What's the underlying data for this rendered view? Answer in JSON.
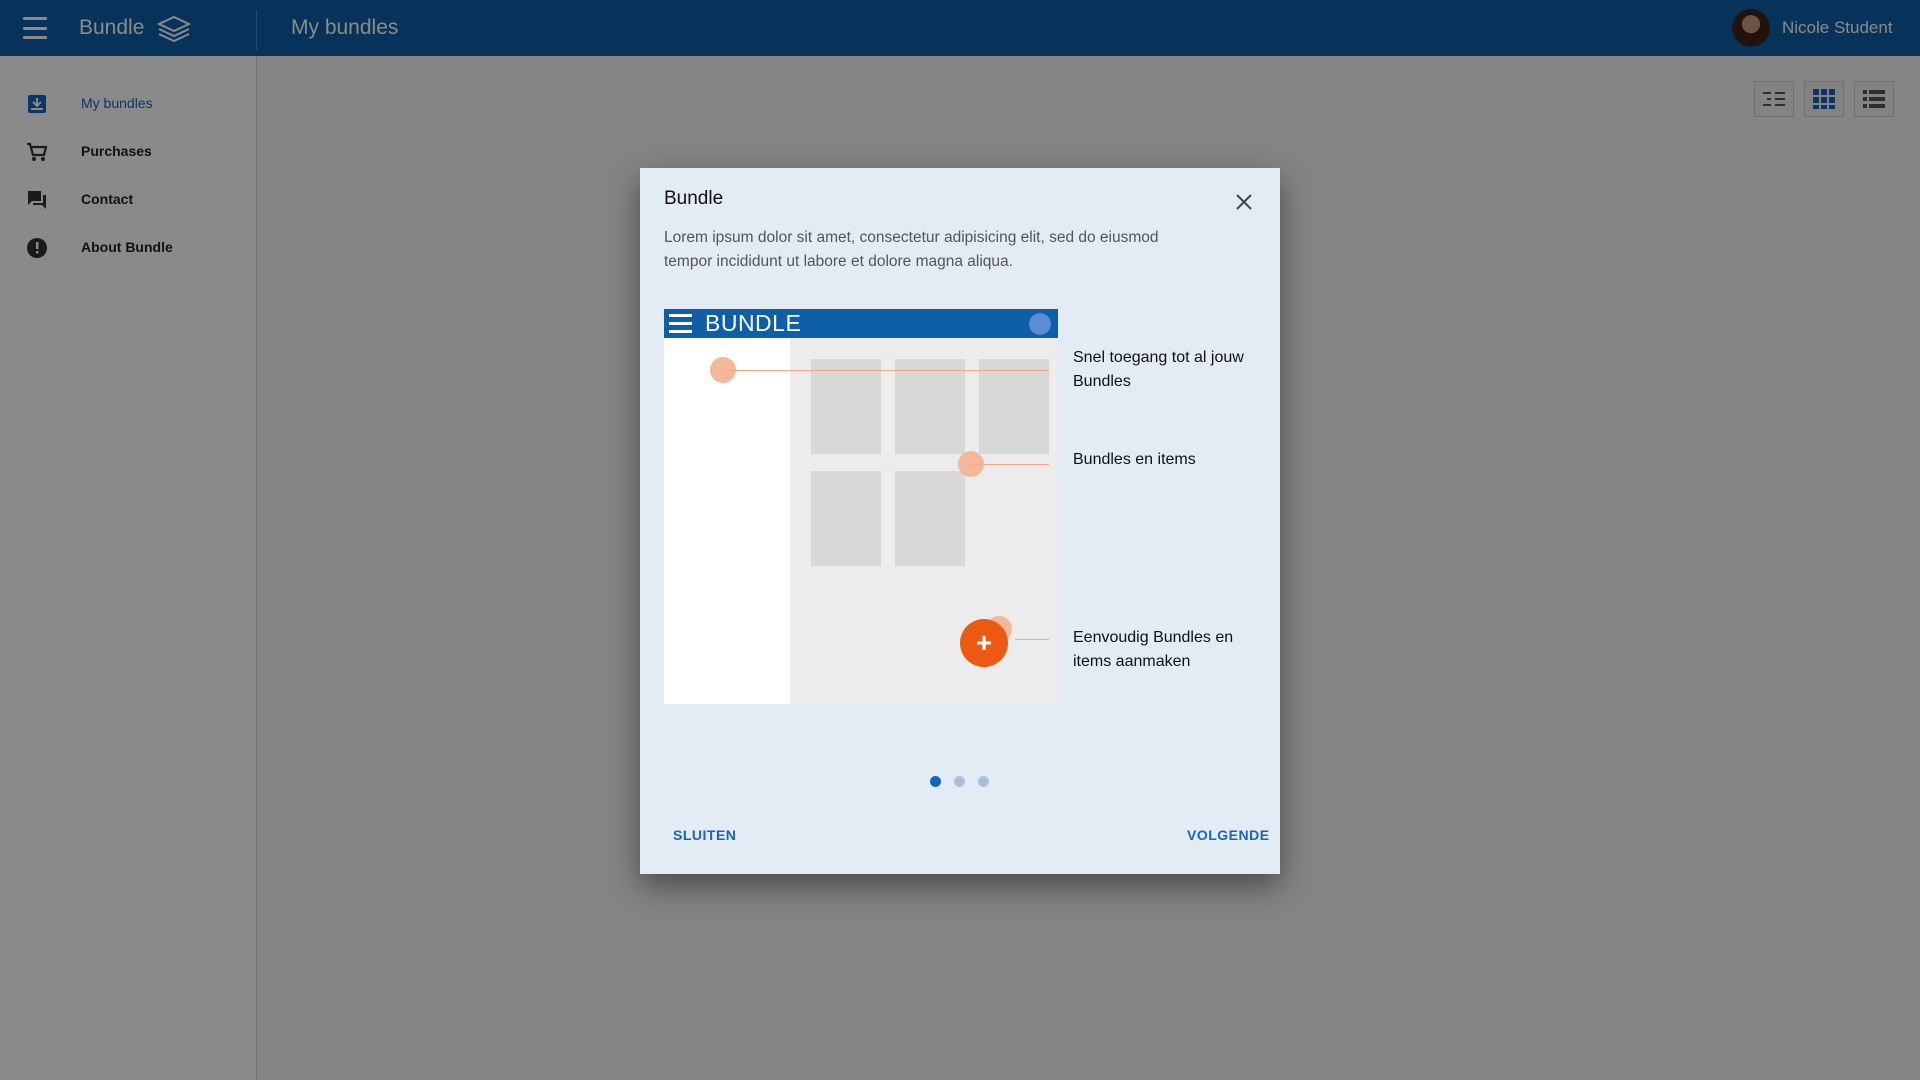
{
  "header": {
    "app_name": "Bundle",
    "page_title": "My bundles",
    "user_name": "Nicole Student"
  },
  "sidebar": {
    "items": [
      {
        "label": "My bundles",
        "icon": "inbox-icon",
        "active": true
      },
      {
        "label": "Purchases",
        "icon": "cart-icon"
      },
      {
        "label": "Contact",
        "icon": "chat-icon"
      },
      {
        "label": "About Bundle",
        "icon": "info-icon"
      }
    ]
  },
  "view_modes": [
    "tree-view-icon",
    "grid-view-icon",
    "list-view-icon"
  ],
  "dialog": {
    "title": "Bundle",
    "description": "Lorem ipsum dolor sit amet, consectetur adipisicing elit, sed do eiusmod tempor incididunt ut labore et dolore magna aliqua.",
    "illustration": {
      "brand": "BUNDLE",
      "fab_symbol": "+"
    },
    "callouts": [
      "Snel toegang tot al jouw Bundles",
      "Bundles en items",
      "Eenvoudig Bundles en items aanmaken"
    ],
    "pager": {
      "current": 1,
      "total": 3
    },
    "close_label": "SLUITEN",
    "next_label": "VOLGENDE"
  },
  "colors": {
    "primary": "#0d5fa8",
    "accent": "#ec5a12",
    "dialog_bg": "#e3ebf5",
    "marker": "#f4b79a"
  }
}
